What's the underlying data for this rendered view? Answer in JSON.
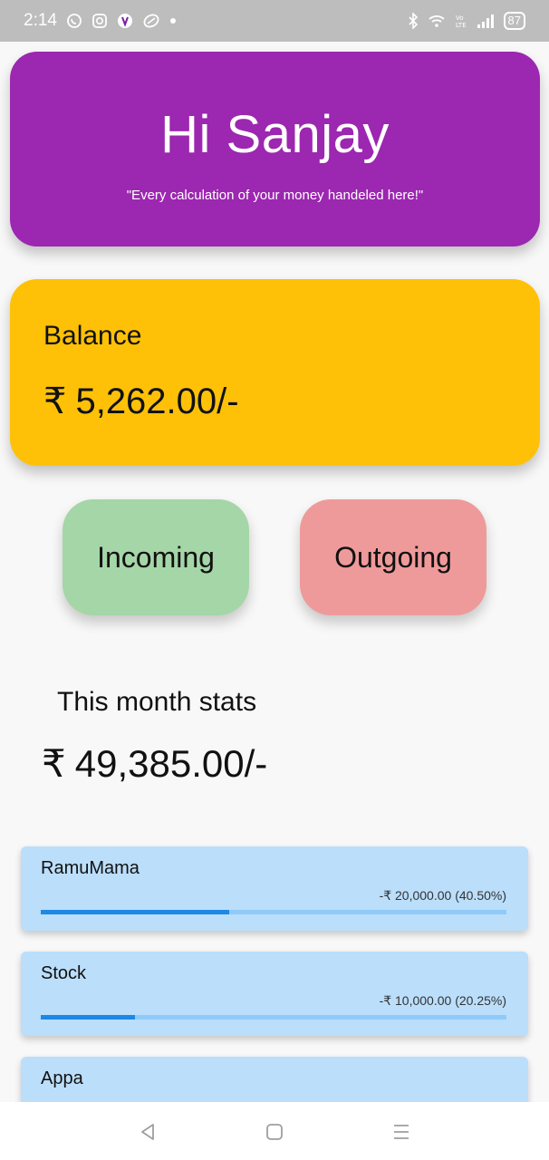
{
  "status_bar": {
    "time": "2:14",
    "battery": "87",
    "left_icons": [
      "whatsapp-icon",
      "instagram-icon",
      "app-icon",
      "vpn-icon",
      "dot-icon"
    ],
    "right_icons": [
      "bluetooth-icon",
      "wifi-icon",
      "volte-icon",
      "signal-icon",
      "battery-icon"
    ]
  },
  "header": {
    "greeting": "Hi Sanjay",
    "quote": "\"Every calculation of your money handeled here!\"",
    "color": "#9c27b0"
  },
  "balance": {
    "label": "Balance",
    "currency": "₹",
    "value": "5,262.00/-",
    "color": "#ffc107"
  },
  "actions": {
    "incoming_label": "Incoming",
    "outgoing_label": "Outgoing",
    "incoming_color": "#a5d6a7",
    "outgoing_color": "#ef9a9a"
  },
  "stats": {
    "title": "This month stats",
    "currency": "₹",
    "value": "49,385.00/-"
  },
  "expenses": [
    {
      "name": "RamuMama",
      "amount": "-₹ 20,000.00 (40.50%)",
      "progress": 0.405
    },
    {
      "name": "Stock",
      "amount": "-₹ 10,000.00 (20.25%)",
      "progress": 0.2025
    },
    {
      "name": "Appa",
      "amount": "",
      "progress": 0
    }
  ],
  "nav": {
    "icons": [
      "back-icon",
      "home-icon",
      "menu-icon"
    ]
  }
}
